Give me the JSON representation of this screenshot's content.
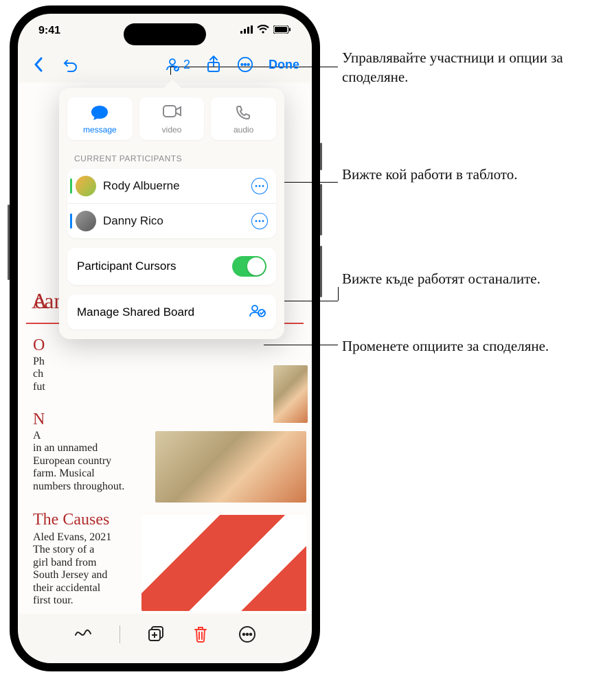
{
  "status": {
    "time": "9:41"
  },
  "toolbar": {
    "participant_count": "2",
    "done": "Done"
  },
  "popover": {
    "contact": {
      "message": "message",
      "video": "video",
      "audio": "audio"
    },
    "participants_header": "CURRENT PARTICIPANTS",
    "participants": [
      {
        "name": "Rody Albuerne",
        "color": "#34c759",
        "avatar_bg": "linear-gradient(135deg,#f6b042,#8bc34a)"
      },
      {
        "name": "Danny Rico",
        "color": "#0a84ff",
        "avatar_bg": "linear-gradient(135deg,#8f8f8f,#595959)"
      }
    ],
    "cursors_label": "Participant Cursors",
    "cursors_on": true,
    "manage_label": "Manage Shared Board"
  },
  "board": {
    "title_fragment_left": "A",
    "title_fragment_right": "eam",
    "section1_heading": "O",
    "section1_body": "Ph\nch\nfut",
    "section2_heading": "N",
    "section2_body": "A\nin an unnamed\nEuropean country\nfarm. Musical\nnumbers throughout.",
    "section3_heading": "The Causes",
    "section3_body": "Aled Evans, 2021\nThe story of a\ngirl band from\nSouth Jersey and\ntheir accidental\nfirst tour."
  },
  "callouts": {
    "c1": "Управлявайте участници и опции за споделяне.",
    "c2": "Вижте кой работи в таблото.",
    "c3": "Вижте къде работят останалите.",
    "c4": "Променете опциите за споделяне."
  }
}
